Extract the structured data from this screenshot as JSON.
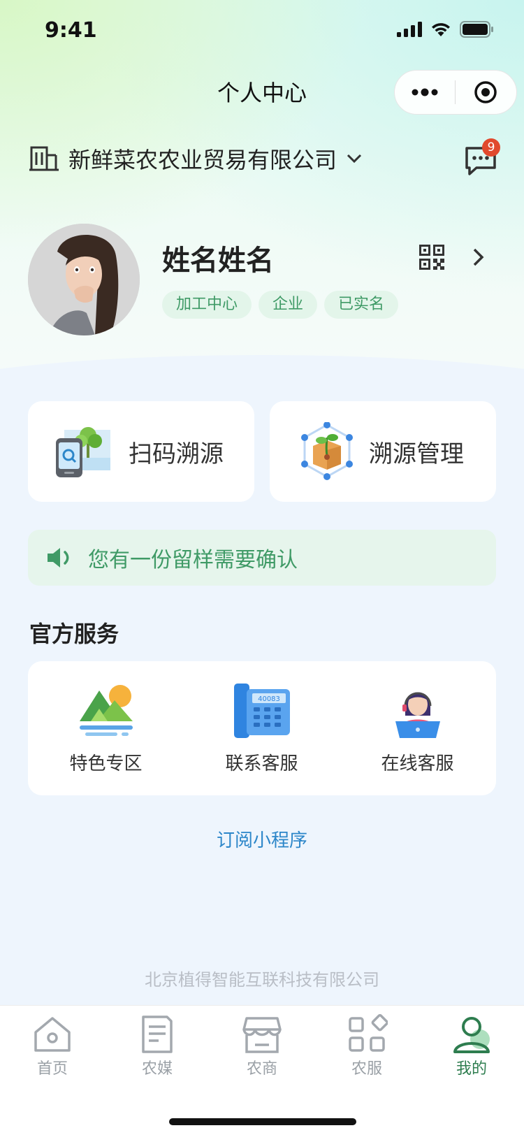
{
  "status_bar": {
    "time": "9:41"
  },
  "nav": {
    "title": "个人中心"
  },
  "company": {
    "name": "新鲜菜农农业贸易有限公司",
    "message_count": "9"
  },
  "profile": {
    "name": "姓名姓名",
    "tags": [
      "加工中心",
      "企业",
      "已实名"
    ]
  },
  "quick_actions": [
    {
      "label": "扫码溯源",
      "icon": "scan-trace-icon"
    },
    {
      "label": "溯源管理",
      "icon": "trace-manage-icon"
    }
  ],
  "notice": {
    "text": "您有一份留样需要确认",
    "icon": "speaker-icon"
  },
  "official_services": {
    "title": "官方服务",
    "items": [
      {
        "label": "特色专区",
        "icon": "landscape-icon"
      },
      {
        "label": "联系客服",
        "icon": "telephone-icon"
      },
      {
        "label": "在线客服",
        "icon": "agent-icon"
      }
    ]
  },
  "subscribe_label": "订阅小程序",
  "footer_company": "北京植得智能互联科技有限公司",
  "tabbar": {
    "items": [
      {
        "label": "首页",
        "icon": "home-icon"
      },
      {
        "label": "农媒",
        "icon": "document-icon"
      },
      {
        "label": "农商",
        "icon": "store-icon"
      },
      {
        "label": "农服",
        "icon": "grid-icon"
      },
      {
        "label": "我的",
        "icon": "user-icon"
      }
    ],
    "active_index": 4
  },
  "colors": {
    "accent_green": "#3f9a66",
    "active_tab": "#2e7d4f",
    "link_blue": "#2c86c9",
    "badge_red": "#e1492d"
  }
}
